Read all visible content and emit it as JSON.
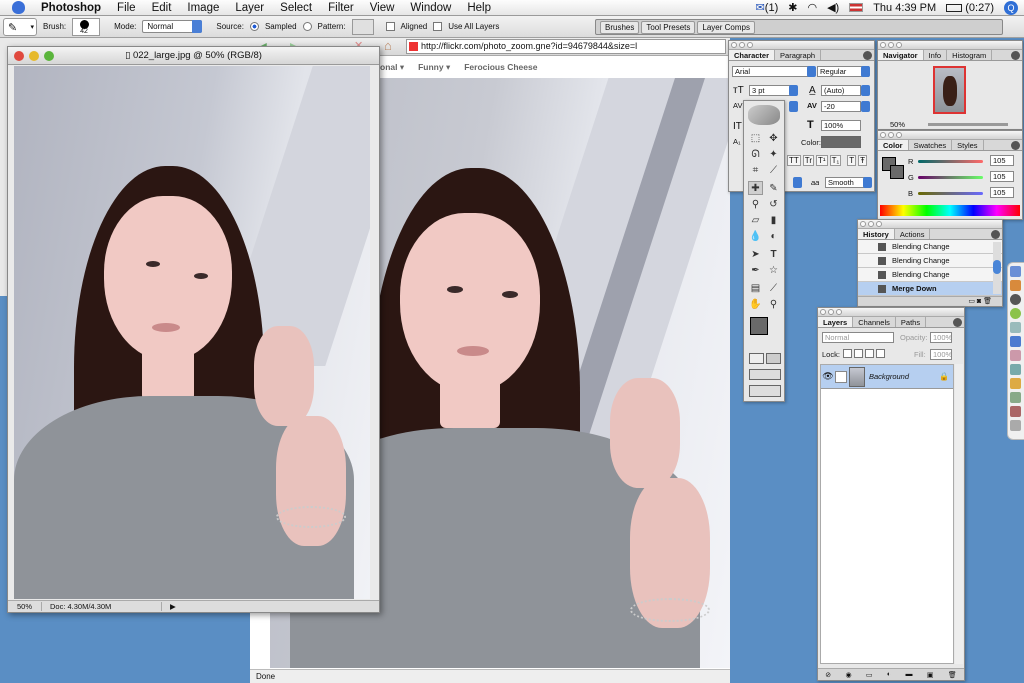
{
  "menubar": {
    "app_name": "Photoshop",
    "menus": [
      "File",
      "Edit",
      "Image",
      "Layer",
      "Select",
      "Filter",
      "View",
      "Window",
      "Help"
    ],
    "mail_count": "(1)",
    "clock": "Thu 4:39 PM",
    "battery": "(0:27)"
  },
  "options_bar": {
    "brush_label": "Brush:",
    "brush_size": "42",
    "mode_label": "Mode:",
    "mode_value": "Normal",
    "source_label": "Source:",
    "sampled_label": "Sampled",
    "pattern_label": "Pattern:",
    "aligned_label": "Aligned",
    "use_all_layers_label": "Use All Layers",
    "well_tabs": [
      "Brushes",
      "Tool Presets",
      "Layer Comps"
    ]
  },
  "browser": {
    "url": "http://flickr.com/photo_zoom.gne?id=94679844&size=l",
    "links": [
      "onal ▾",
      "Funny ▾",
      "Ferocious Cheese"
    ],
    "status": "Done"
  },
  "document": {
    "title": "022_large.jpg @ 50% (RGB/8)",
    "zoom": "50%",
    "doc_size": "Doc: 4.30M/4.30M"
  },
  "character_panel": {
    "tabs": [
      "Character",
      "Paragraph"
    ],
    "font_family": "Arial",
    "font_style": "Regular",
    "font_size": "3 pt",
    "leading": "(Auto)",
    "tracking": "-20",
    "vertical_scale": "100%",
    "color_label": "Color:",
    "antialias": "Smooth",
    "aa_label": "aa",
    "style_buttons": [
      "TT",
      "Tr",
      "T¹",
      "T₁",
      "T",
      "Ŧ"
    ]
  },
  "navigator_panel": {
    "tabs": [
      "Navigator",
      "Info",
      "Histogram"
    ],
    "zoom": "50%"
  },
  "color_panel": {
    "tabs": [
      "Color",
      "Swatches",
      "Styles"
    ],
    "channels": [
      {
        "label": "R",
        "value": "105"
      },
      {
        "label": "G",
        "value": "105"
      },
      {
        "label": "B",
        "value": "105"
      }
    ]
  },
  "history_panel": {
    "tabs": [
      "History",
      "Actions"
    ],
    "items": [
      "Blending Change",
      "Blending Change",
      "Blending Change",
      "Merge Down"
    ]
  },
  "layers_panel": {
    "tabs": [
      "Layers",
      "Channels",
      "Paths"
    ],
    "blend_mode": "Normal",
    "opacity_label": "Opacity:",
    "opacity_value": "100%",
    "lock_label": "Lock:",
    "fill_label": "Fill:",
    "fill_value": "100%",
    "layer_name": "Background"
  },
  "colors": {
    "desktop": "#5a8ec4",
    "selection": "#b6cff0",
    "foreground": "#696969"
  }
}
